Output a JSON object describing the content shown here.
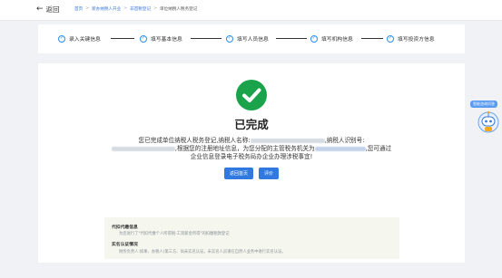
{
  "topbar": {
    "back_label": "返回",
    "breadcrumb": [
      "首页",
      "新办纳税人开业",
      "非首税登记",
      "单位纳税人税务登记"
    ]
  },
  "steps": [
    {
      "label": "录入关键信息"
    },
    {
      "label": "填写基本信息"
    },
    {
      "label": "填写人员信息"
    },
    {
      "label": "填写机构信息"
    },
    {
      "label": "填写投资方信息"
    }
  ],
  "result": {
    "title": "已完成",
    "msg_part1": "您已完成单位纳税人税务登记,纳税人名称:",
    "msg_part2": ",纳税人识别号:",
    "msg_part3": ",根据您的注册地址信息，为您分配的主管税务机关为",
    "msg_part4": ",您可通过企业信息登录电子税务局办企业办理涉税事宜!",
    "btn_home": "返回首页",
    "btn_rate": "评价"
  },
  "info": {
    "agent_title": "代扣代缴信息",
    "agent_text": "为您进行了\"代扣代缴个人所得税-工资薪金所得\"的扣缴税款登记",
    "realname_title": "实名认证情况",
    "realname_text": "财务负责人:如果、办税人(第三方、尚未实名认证。未实名人员请在自然人业务中进行实名认证。"
  },
  "assistant": {
    "bubble": "智能咨询问答"
  },
  "colors": {
    "accent": "#2f79e0",
    "success": "#1aa34a",
    "page_bg": "#f1f2f5"
  }
}
